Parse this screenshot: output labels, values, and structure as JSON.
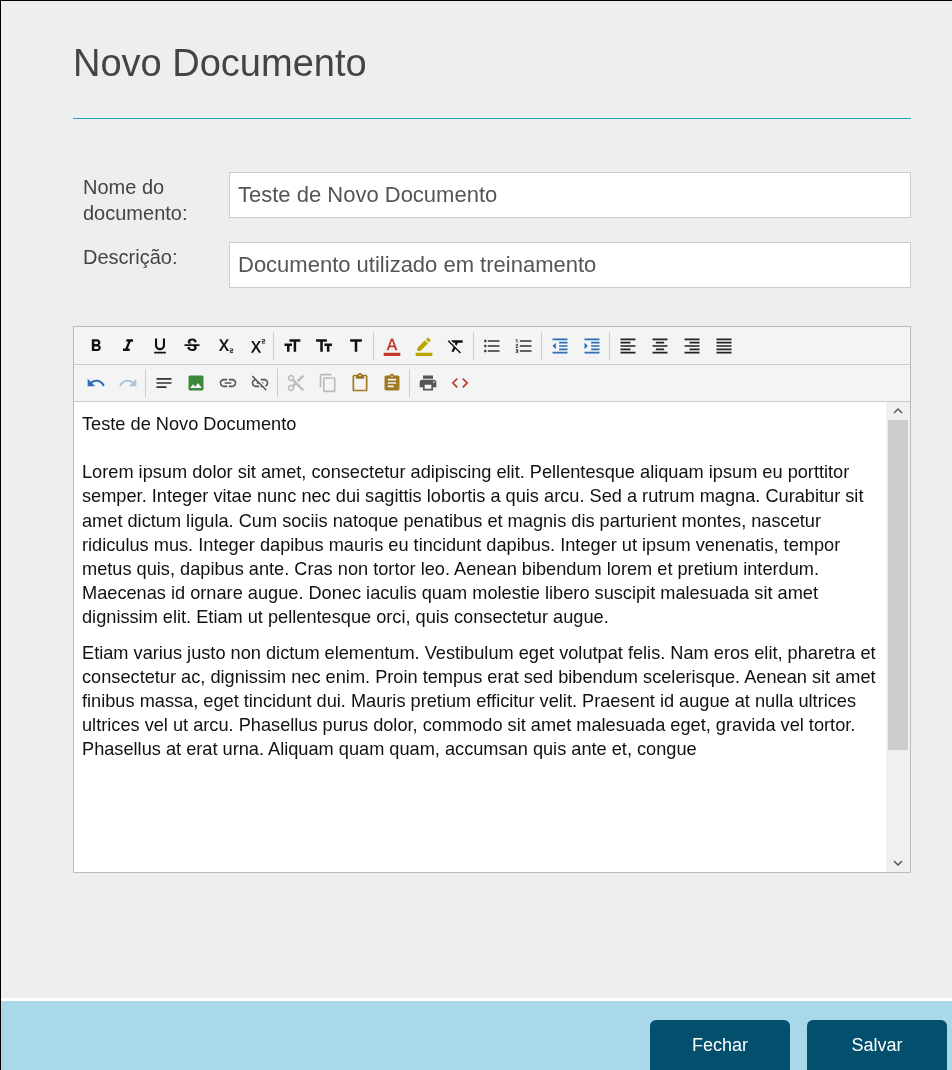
{
  "title": "Novo Documento",
  "fields": [
    {
      "label": "Nome do documento:",
      "value": "Teste de Novo Documento"
    },
    {
      "label": "Descrição:",
      "value": "Documento utilizado em treinamento"
    }
  ],
  "editor": {
    "toolbar_rows": [
      [
        [
          {
            "kind": "bold",
            "disabled": false
          },
          {
            "kind": "italic",
            "disabled": false
          },
          {
            "kind": "underline",
            "disabled": false
          },
          {
            "kind": "strike",
            "disabled": false
          },
          {
            "kind": "subscript",
            "disabled": false
          },
          {
            "kind": "superscript",
            "disabled": false
          }
        ],
        [
          {
            "kind": "font-size",
            "disabled": false
          },
          {
            "kind": "text-size",
            "disabled": false
          },
          {
            "kind": "heading",
            "disabled": false
          }
        ],
        [
          {
            "kind": "text-color",
            "disabled": false
          },
          {
            "kind": "highlight",
            "disabled": false
          },
          {
            "kind": "clear-format",
            "disabled": false
          }
        ],
        [
          {
            "kind": "bullet-list",
            "disabled": false
          },
          {
            "kind": "numbered-list",
            "disabled": false
          }
        ],
        [
          {
            "kind": "outdent",
            "disabled": false
          },
          {
            "kind": "indent",
            "disabled": false
          }
        ],
        [
          {
            "kind": "align-left",
            "disabled": false
          },
          {
            "kind": "align-center",
            "disabled": false
          },
          {
            "kind": "align-right",
            "disabled": false
          },
          {
            "kind": "align-justify",
            "disabled": false
          }
        ]
      ],
      [
        [
          {
            "kind": "undo",
            "disabled": false
          },
          {
            "kind": "redo",
            "disabled": true
          }
        ],
        [
          {
            "kind": "horizontal-rule",
            "disabled": false
          },
          {
            "kind": "image",
            "disabled": false
          },
          {
            "kind": "link",
            "disabled": false
          },
          {
            "kind": "unlink",
            "disabled": false
          }
        ],
        [
          {
            "kind": "cut",
            "disabled": true
          },
          {
            "kind": "copy",
            "disabled": true
          },
          {
            "kind": "paste",
            "disabled": false
          },
          {
            "kind": "paste-text",
            "disabled": false
          }
        ],
        [
          {
            "kind": "print",
            "disabled": false
          },
          {
            "kind": "source",
            "disabled": false
          }
        ]
      ]
    ],
    "heading": "Teste de Novo Documento",
    "paragraphs": [
      "Lorem ipsum dolor sit amet, consectetur adipiscing elit. Pellentesque aliquam ipsum eu porttitor semper. Integer vitae nunc nec dui sagittis lobortis a quis arcu. Sed a rutrum magna. Curabitur sit amet dictum ligula. Cum sociis natoque penatibus et magnis dis parturient montes, nascetur ridiculus mus. Integer dapibus mauris eu tincidunt dapibus. Integer ut ipsum venenatis, tempor metus quis, dapibus ante. Cras non tortor leo. Aenean bibendum lorem et pretium interdum. Maecenas id ornare augue. Donec iaculis quam molestie libero suscipit malesuada sit amet dignissim elit. Etiam ut pellentesque orci, quis consectetur augue.",
      "Etiam varius justo non dictum elementum. Vestibulum eget volutpat felis. Nam eros elit, pharetra et consectetur ac, dignissim nec enim. Proin tempus erat sed bibendum scelerisque. Aenean sit amet finibus massa, eget tincidunt dui. Mauris pretium efficitur velit. Praesent id augue at nulla ultrices ultrices vel ut arcu. Phasellus purus dolor, commodo sit amet malesuada eget, gravida vel tortor. Phasellus at erat urna. Aliquam quam quam, accumsan quis ante et, congue"
    ]
  },
  "buttons": [
    "Fechar",
    "Salvar"
  ]
}
